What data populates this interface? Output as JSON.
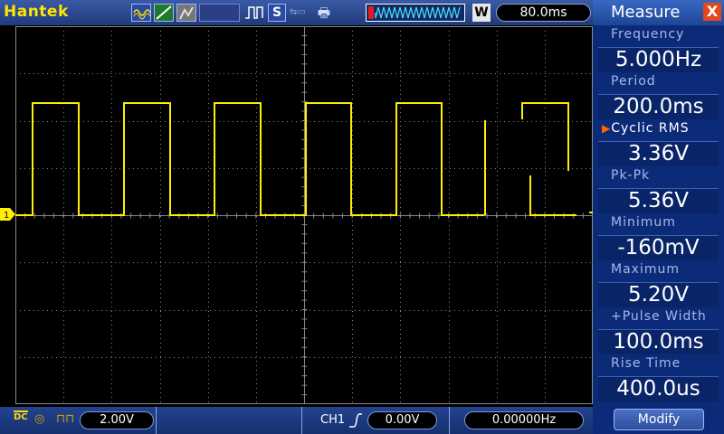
{
  "topbar": {
    "brand": "Hantek",
    "timebase": "80.0ms",
    "icons": [
      "waveform-icon",
      "ramp-icon",
      "grayscale-icon",
      "blank-slot",
      "pulse-icon",
      "s-icon",
      "usb-icon",
      "save-icon",
      "timebase-window-icon",
      "w-icon"
    ],
    "w_label": "W",
    "s_label": "S"
  },
  "screen": {
    "channel_marker": "1",
    "trace_color": "#ffee00",
    "grid_color": "#888888"
  },
  "bottombar": {
    "coupling": "DC",
    "ch1_volts": "2.00V",
    "trigger_source": "CH1",
    "trigger_level": "0.00V",
    "trigger_freq": "0.00000Hz"
  },
  "panel": {
    "title": "Measure",
    "close_label": "X",
    "measurements": [
      {
        "label": "Frequency",
        "value": "5.000Hz"
      },
      {
        "label": "Period",
        "value": "200.0ms"
      },
      {
        "label": "Cyclic RMS",
        "value": "3.36V",
        "selected": true
      },
      {
        "label": "Pk-Pk",
        "value": "5.36V"
      },
      {
        "label": "Minimum",
        "value": "-160mV"
      },
      {
        "label": "Maximum",
        "value": "5.20V"
      },
      {
        "label": "+Pulse Width",
        "value": "100.0ms"
      },
      {
        "label": "Rise Time",
        "value": "400.0us"
      }
    ],
    "modify_label": "Modify"
  },
  "colors": {
    "panel_bg": "#0b2b78",
    "topbar_bg": "#2a4a96",
    "trace": "#ffee00",
    "close": "#e5471d"
  }
}
